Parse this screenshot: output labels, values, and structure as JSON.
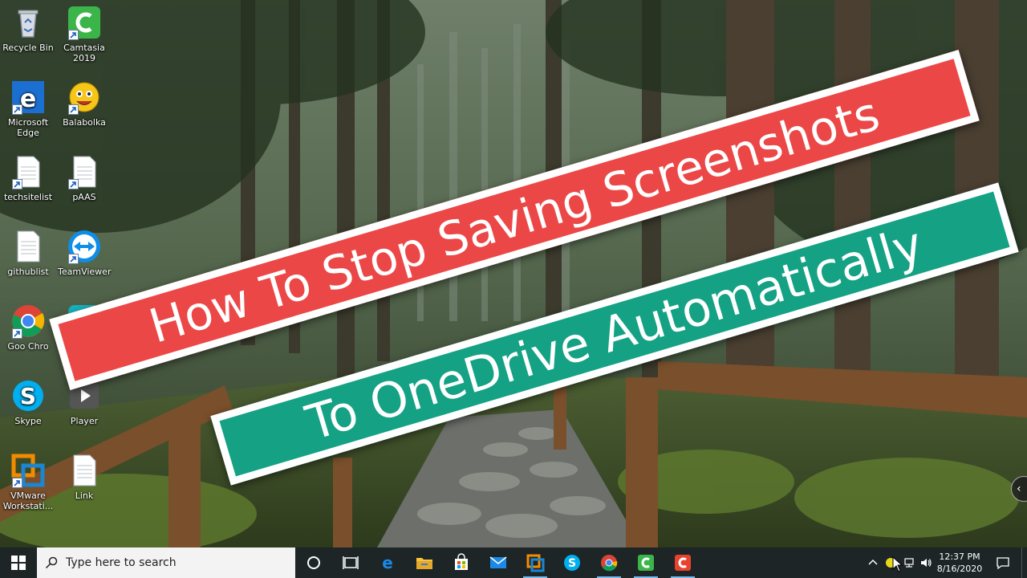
{
  "desktop_icons": [
    {
      "id": "recycle-bin",
      "label": "Recycle Bin",
      "icon": "recycle-bin-icon"
    },
    {
      "id": "camtasia",
      "label": "Camtasia 2019",
      "icon": "camtasia-icon"
    },
    {
      "id": "edge",
      "label": "Microsoft Edge",
      "icon": "edge-icon"
    },
    {
      "id": "balabolka",
      "label": "Balabolka",
      "icon": "balabolka-icon"
    },
    {
      "id": "techsitelist",
      "label": "techsitelist",
      "icon": "text-file-icon"
    },
    {
      "id": "paas",
      "label": "pAAS",
      "icon": "text-file-icon"
    },
    {
      "id": "githublist",
      "label": "githublist",
      "icon": "text-file-icon"
    },
    {
      "id": "teamviewer",
      "label": "TeamViewer",
      "icon": "teamviewer-icon"
    },
    {
      "id": "chrome",
      "label": "Goo Chro",
      "icon": "chrome-icon"
    },
    {
      "id": "kodi",
      "label": "",
      "icon": "kodi-icon"
    },
    {
      "id": "skype",
      "label": "Skype",
      "icon": "skype-icon"
    },
    {
      "id": "player",
      "label": "Player",
      "icon": "player-icon"
    },
    {
      "id": "vmware",
      "label": "VMware Workstati...",
      "icon": "vmware-icon"
    },
    {
      "id": "link",
      "label": "Link",
      "icon": "text-file-icon"
    }
  ],
  "banners": {
    "line1": "How To Stop Saving Screenshots",
    "line2": "To OneDrive Automatically",
    "colors": {
      "line1_bg": "#ec4747",
      "line2_bg": "#14a184",
      "border": "#ffffff"
    }
  },
  "taskbar": {
    "search_placeholder": "Type here to search",
    "apps": [
      "cortana-icon",
      "task-view-icon",
      "edge-icon",
      "file-explorer-icon",
      "store-icon",
      "mail-icon",
      "teamviewer-icon",
      "skype-icon",
      "chrome-icon",
      "camtasia-icon",
      "camtasia-recorder-icon"
    ],
    "clock": {
      "time": "12:37 PM",
      "date": "8/16/2020"
    }
  }
}
